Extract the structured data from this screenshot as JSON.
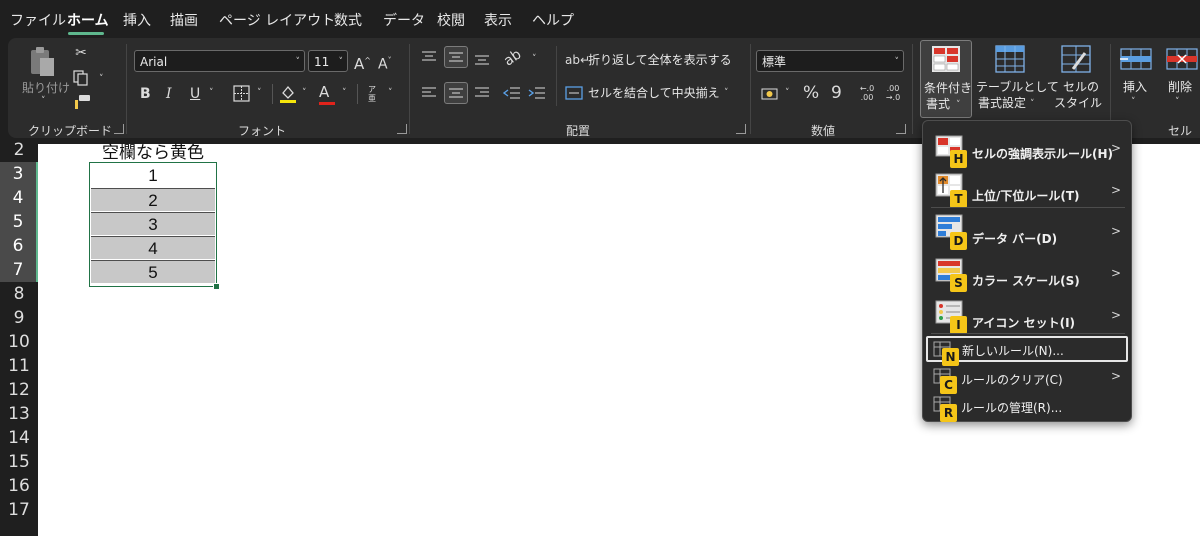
{
  "menu_tabs": [
    "ファイル",
    "ホーム",
    "挿入",
    "描画",
    "ページ レイアウト",
    "数式",
    "データ",
    "校閲",
    "表示",
    "ヘルプ"
  ],
  "active_tab": "ホーム",
  "colors": {
    "accent": "#5fb88e",
    "ribbon_bg": "#2c2c2c",
    "title_bg": "#1f1f1f",
    "cell_fill": "#c8c8c8",
    "key_tip": "#f5c518",
    "selection_border": "#217346"
  },
  "ribbon": {
    "clipboard": {
      "label": "クリップボード",
      "paste_label": "貼り付け",
      "icons": [
        "paste-icon",
        "cut-icon",
        "copy-icon",
        "format-painter-icon"
      ]
    },
    "font": {
      "label": "フォント",
      "font_name": "Arial",
      "font_size": "11",
      "increase_icon": "A^",
      "decrease_icon": "A˅",
      "bold": "B",
      "italic": "I",
      "underline": "U",
      "font_color_icon": "A",
      "phonetic_icon": "ア亜"
    },
    "alignment": {
      "label": "配置",
      "wrap_text": "折り返して全体を表示する",
      "merge_center": "セルを結合して中央揃え"
    },
    "number": {
      "label": "数値",
      "format": "標準",
      "percent": "%",
      "comma": "9",
      "inc_decimal": "←.0 .00",
      "dec_decimal": ".00 →.0"
    },
    "styles": {
      "conditional_formatting": [
        "条件付き",
        "書式"
      ],
      "format_as_table": [
        "テーブルとして",
        "書式設定"
      ],
      "cell_styles": [
        "セルの",
        "スタイル"
      ]
    },
    "cells": {
      "label": "セル",
      "insert": "挿入",
      "delete": "削除"
    }
  },
  "row_headers": [
    "2",
    "3",
    "4",
    "5",
    "6",
    "7",
    "8",
    "9",
    "10",
    "11",
    "12",
    "13",
    "14",
    "15",
    "16",
    "17"
  ],
  "selected_rows": [
    "3",
    "4",
    "5",
    "6",
    "7"
  ],
  "sheet": {
    "header_cell": "空欄なら黄色",
    "values": [
      "1",
      "2",
      "3",
      "4",
      "5"
    ]
  },
  "conditional_menu": {
    "items": [
      {
        "label": "セルの強調表示ルール(H)",
        "key": "H",
        "submenu": true
      },
      {
        "label": "上位/下位ルール(T)",
        "key": "T",
        "submenu": true
      },
      {
        "label": "データ バー(D)",
        "key": "D",
        "submenu": true
      },
      {
        "label": "カラー スケール(S)",
        "key": "S",
        "submenu": true
      },
      {
        "label": "アイコン セット(I)",
        "key": "I",
        "submenu": true
      },
      {
        "label": "新しいルール(N)...",
        "key": "N",
        "submenu": false
      },
      {
        "label": "ルールのクリア(C)",
        "key": "C",
        "submenu": true
      },
      {
        "label": "ルールの管理(R)...",
        "key": "R",
        "submenu": false
      }
    ]
  }
}
